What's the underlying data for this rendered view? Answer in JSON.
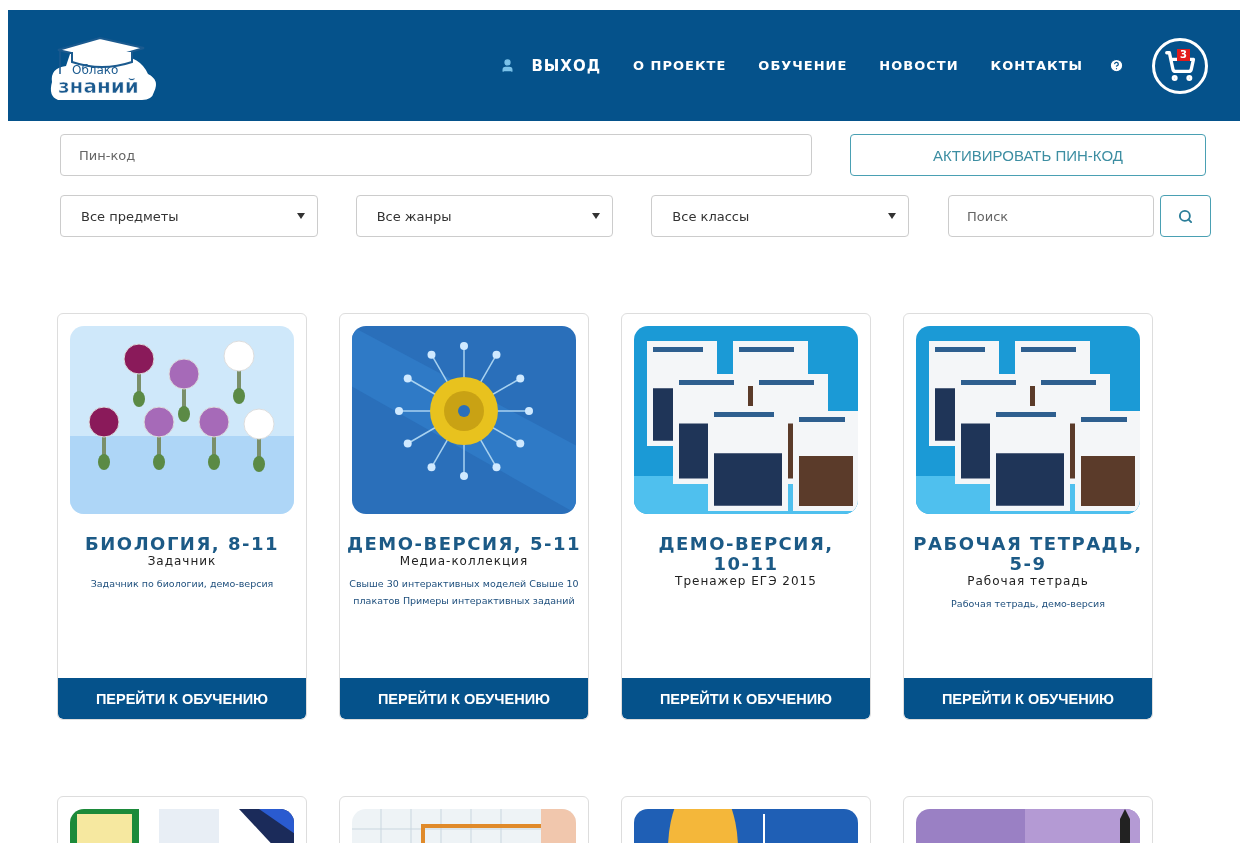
{
  "header": {
    "logo": {
      "line_1": "Облако",
      "line_2": "знаний"
    },
    "nav": [
      {
        "kind": "user",
        "label": "ВЫХОД"
      },
      {
        "kind": "link",
        "label": "О ПРОЕКТЕ"
      },
      {
        "kind": "link",
        "label": "ОБУЧЕНИЕ"
      },
      {
        "kind": "link",
        "label": "НОВОСТИ"
      },
      {
        "kind": "link",
        "label": "КОНТАКТЫ"
      },
      {
        "kind": "help"
      }
    ],
    "cart": {
      "badge": "3"
    }
  },
  "pin": {
    "placeholder": "Пин-код",
    "button": "АКТИВИРОВАТЬ ПИН-КОД"
  },
  "filters": [
    {
      "value": "Все предметы"
    },
    {
      "value": "Все жанры"
    },
    {
      "value": "Все классы"
    }
  ],
  "search": {
    "placeholder": "Поиск"
  },
  "cards": [
    {
      "title": "БИОЛОГИЯ, 8-11",
      "subtitle": "Задачник",
      "description": "Задачник по биологии, демо-версия",
      "button": "ПЕРЕЙТИ К ОБУЧЕНИЮ"
    },
    {
      "title": "ДЕМО-ВЕРСИЯ, 5-11",
      "subtitle": "Медиа-коллекция",
      "description": "Свыше 30 интерактивных моделей Свыше 10 плакатов Примеры интерактивных заданий",
      "button": "ПЕРЕЙТИ К ОБУЧЕНИЮ"
    },
    {
      "title": "ДЕМО-ВЕРСИЯ, 10-11",
      "subtitle": "Тренажер ЕГЭ 2015",
      "button": "ПЕРЕЙТИ К ОБУЧЕНИЮ"
    },
    {
      "title": "РАБОЧАЯ ТЕТРАДЬ, 5-9",
      "subtitle": "Рабочая тетрадь",
      "description": "Рабочая тетрадь, демо-версия",
      "button": "ПЕРЕЙТИ К ОБУЧЕНИЮ"
    }
  ]
}
